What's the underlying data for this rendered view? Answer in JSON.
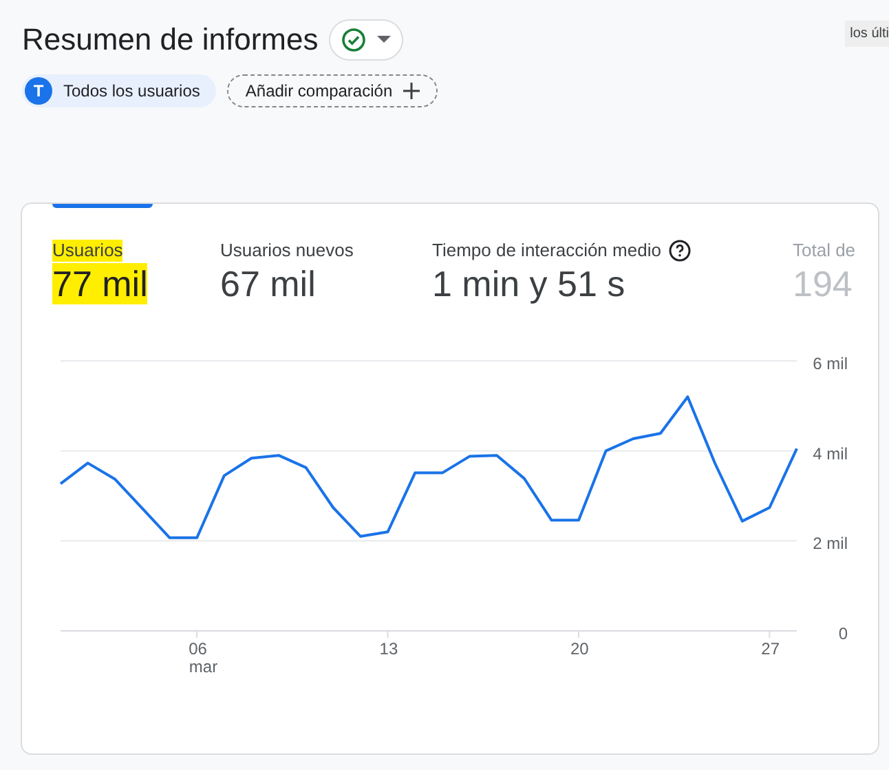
{
  "header": {
    "title": "Resumen de informes",
    "date_badge": "los últi"
  },
  "comparison": {
    "segment": {
      "initial": "T",
      "label": "Todos los usuarios"
    },
    "add_button": "Añadir comparación"
  },
  "metrics": [
    {
      "label": "Usuarios",
      "value": "77 mil",
      "selected": true,
      "highlighted": true,
      "faded": false,
      "help": false
    },
    {
      "label": "Usuarios nuevos",
      "value": "67 mil",
      "selected": false,
      "highlighted": false,
      "faded": false,
      "help": false
    },
    {
      "label": "Tiempo de interacción medio",
      "value": "1 min y 51 s",
      "selected": false,
      "highlighted": false,
      "faded": false,
      "help": true
    },
    {
      "label": "Total de",
      "value": "194",
      "selected": false,
      "highlighted": false,
      "faded": true,
      "help": false
    }
  ],
  "chart_data": {
    "type": "line",
    "x": [
      1,
      2,
      3,
      4,
      5,
      6,
      7,
      8,
      9,
      10,
      11,
      12,
      13,
      14,
      15,
      16,
      17,
      18,
      19,
      20,
      21,
      22,
      23,
      24,
      25,
      26,
      27,
      28
    ],
    "series": [
      {
        "color": "#1a73e8",
        "values": [
          3.27,
          3.73,
          3.37,
          2.72,
          2.07,
          2.07,
          3.45,
          3.84,
          3.9,
          3.63,
          2.74,
          2.1,
          2.2,
          3.51,
          3.51,
          3.88,
          3.9,
          3.39,
          2.46,
          2.46,
          4.0,
          4.27,
          4.39,
          5.2,
          3.72,
          2.44,
          2.74,
          4.05
        ]
      }
    ],
    "xlim": [
      1,
      28
    ],
    "ylim": [
      0,
      6
    ],
    "xticks": [
      {
        "value": 6,
        "label": "06 mar"
      },
      {
        "value": 13,
        "label": "13"
      },
      {
        "value": 20,
        "label": "20"
      },
      {
        "value": 27,
        "label": "27"
      }
    ],
    "yticks": [
      {
        "value": 0,
        "label": "0"
      },
      {
        "value": 2,
        "label": "2 mil"
      },
      {
        "value": 4,
        "label": "4 mil"
      },
      {
        "value": 6,
        "label": "6 mil"
      }
    ]
  }
}
